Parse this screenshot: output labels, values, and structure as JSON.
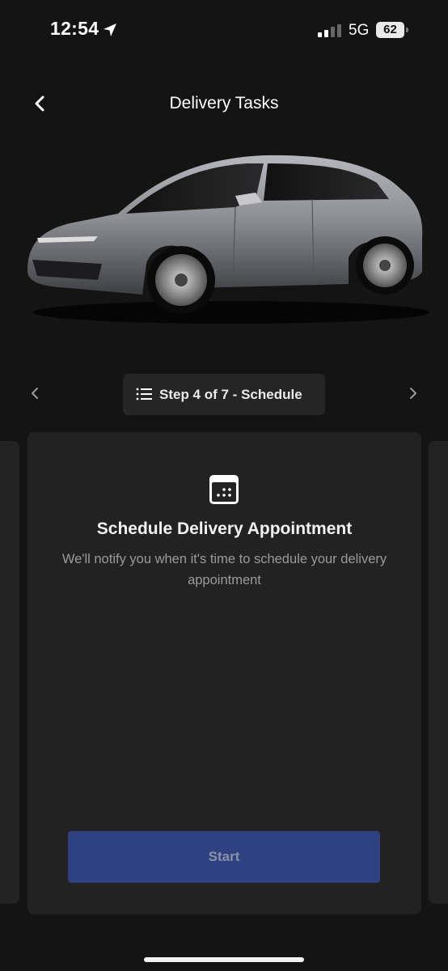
{
  "status_bar": {
    "time": "12:54",
    "network": "5G",
    "battery": "62",
    "location_icon": "location-arrow-icon",
    "signal_icon": "cell-signal-icon"
  },
  "header": {
    "title": "Delivery Tasks",
    "back_icon": "chevron-left-icon"
  },
  "hero": {
    "image": "car-image"
  },
  "step_nav": {
    "label": "Step 4 of 7 - Schedule",
    "list_icon": "list-icon",
    "prev_icon": "chevron-left-icon",
    "next_icon": "chevron-right-icon"
  },
  "card": {
    "icon": "calendar-icon",
    "title": "Schedule Delivery Appointment",
    "description": "We'll notify you when it's time to schedule your delivery appointment",
    "button_label": "Start"
  },
  "colors": {
    "background": "#141414",
    "card": "#222222",
    "button": "#2f4180"
  }
}
